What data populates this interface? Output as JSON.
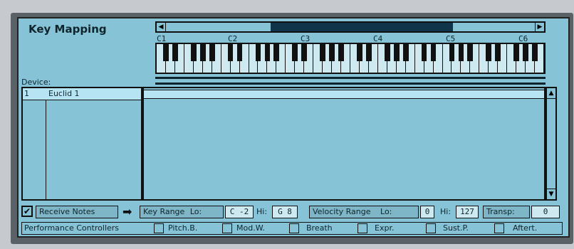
{
  "title": "Key Mapping",
  "octaves": [
    "C1",
    "C2",
    "C3",
    "C4",
    "C5",
    "C6"
  ],
  "device_label": "Device:",
  "device_row": {
    "num": "1",
    "name": "Euclid 1"
  },
  "row1": {
    "receive_notes": "Receive Notes",
    "key_range": "Key Range",
    "lo_label": "Lo:",
    "lo_value": "C -2",
    "hi_label": "Hi:",
    "hi_value": "G 8",
    "velocity_range": "Velocity Range",
    "vlo_label": "Lo:",
    "vlo_value": "0",
    "vhi_label": "Hi:",
    "vhi_value": "127",
    "transp_label": "Transp:",
    "transp_value": "0"
  },
  "row2": {
    "performance": "Performance Controllers",
    "pitch": "Pitch.B.",
    "mod": "Mod.W.",
    "breath": "Breath",
    "expr": "Expr.",
    "sust": "Sust.P.",
    "aftert": "Aftert."
  },
  "colors": {
    "panel": "#86c3d6",
    "dark": "#10344a"
  }
}
